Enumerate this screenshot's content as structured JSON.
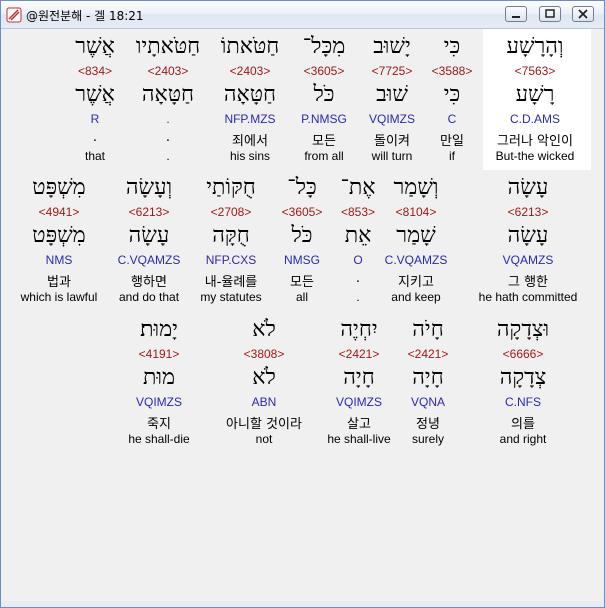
{
  "window": {
    "title": "@원전분해 - 겔 18:21"
  },
  "colors": {
    "strong": "#a01818",
    "morph": "#2a2ab0"
  },
  "rows": [
    {
      "words": [
        {
          "hebrew": "אֲשֶׁר",
          "strong": "<834>",
          "lemma": "אֲשֶׁר",
          "morph": "R",
          "korean": ".",
          "english": "that"
        },
        {
          "hebrew": "חַטֹּאתָיו",
          "strong": "<2403>",
          "lemma": "חַטָּאָה",
          "morph": ".",
          "korean": ".",
          "english": "."
        },
        {
          "hebrew": "חַטֹּאתוֹ",
          "strong": "<2403>",
          "lemma": "חַטָּאָה",
          "morph": "NFP.MZS",
          "korean": "죄에서",
          "english": "his sins"
        },
        {
          "hebrew": "מִכָּל־",
          "strong": "<3605>",
          "lemma": "כֹּל",
          "morph": "P.NMSG",
          "korean": "모든",
          "english": "from all"
        },
        {
          "hebrew": "יָשׁוּב",
          "strong": "<7725>",
          "lemma": "שׁוּב",
          "morph": "VQIMZS",
          "korean": "돌이켜",
          "english": "will turn"
        },
        {
          "hebrew": "כִּי",
          "strong": "<3588>",
          "lemma": "כִּי",
          "morph": "C",
          "korean": "만일",
          "english": "if"
        },
        {
          "hebrew": "וְהָרָשָׁע",
          "strong": "<7563>",
          "lemma": "רָשָׁע",
          "morph": "C.D.AMS",
          "korean": "그러나 악인이",
          "english": "But-the wicked"
        }
      ]
    },
    {
      "words": [
        {
          "hebrew": "מִשְׁפָּט",
          "strong": "<4941>",
          "lemma": "מִשְׁפָּט",
          "morph": "NMS",
          "korean": "법과",
          "english": "which is lawful"
        },
        {
          "hebrew": "וְעָשָׂה",
          "strong": "<6213>",
          "lemma": "עָשָׂה",
          "morph": "C.VQAMZS",
          "korean": "행하면",
          "english": "and do that"
        },
        {
          "hebrew": "חֻקּוֹתַי",
          "strong": "<2708>",
          "lemma": "חֻקָּה",
          "morph": "NFP.CXS",
          "korean": "내-율례를",
          "english": "my statutes"
        },
        {
          "hebrew": "כָּל־",
          "strong": "<3605>",
          "lemma": "כֹּל",
          "morph": "NMSG",
          "korean": "모든",
          "english": "all"
        },
        {
          "hebrew": "אֶת־",
          "strong": "<853>",
          "lemma": "אֵת",
          "morph": "O",
          "korean": ".",
          "english": "."
        },
        {
          "hebrew": "וְשָׁמַר",
          "strong": "<8104>",
          "lemma": "שָׁמַר",
          "morph": "C.VQAMZS",
          "korean": "지키고",
          "english": "and keep"
        },
        {
          "hebrew": "עָשָׂה",
          "strong": "<6213>",
          "lemma": "עָשָׂה",
          "morph": "VQAMZS",
          "korean": "그 행한",
          "english": "he hath committed"
        }
      ]
    },
    {
      "words": [
        {
          "hebrew": "יָמוּת׃",
          "strong": "<4191>",
          "lemma": "מוּת",
          "morph": "VQIMZS",
          "korean": "죽지",
          "english": "he shall-die"
        },
        {
          "hebrew": "לֹא",
          "strong": "<3808>",
          "lemma": "לֹא",
          "morph": "ABN",
          "korean": "아니할 것이라",
          "english": "not"
        },
        {
          "hebrew": "יִחְיֶה",
          "strong": "<2421>",
          "lemma": "חָיָה",
          "morph": "VQIMZS",
          "korean": "살고",
          "english": "he shall-live"
        },
        {
          "hebrew": "חָיֹה",
          "strong": "<2421>",
          "lemma": "חָיָה",
          "morph": "VQNA",
          "korean": "정녕",
          "english": "surely"
        },
        {
          "hebrew": "וּצְדָקָה",
          "strong": "<6666>",
          "lemma": "צְדָקָה",
          "morph": "C.NFS",
          "korean": "의를",
          "english": "and right"
        }
      ]
    }
  ]
}
